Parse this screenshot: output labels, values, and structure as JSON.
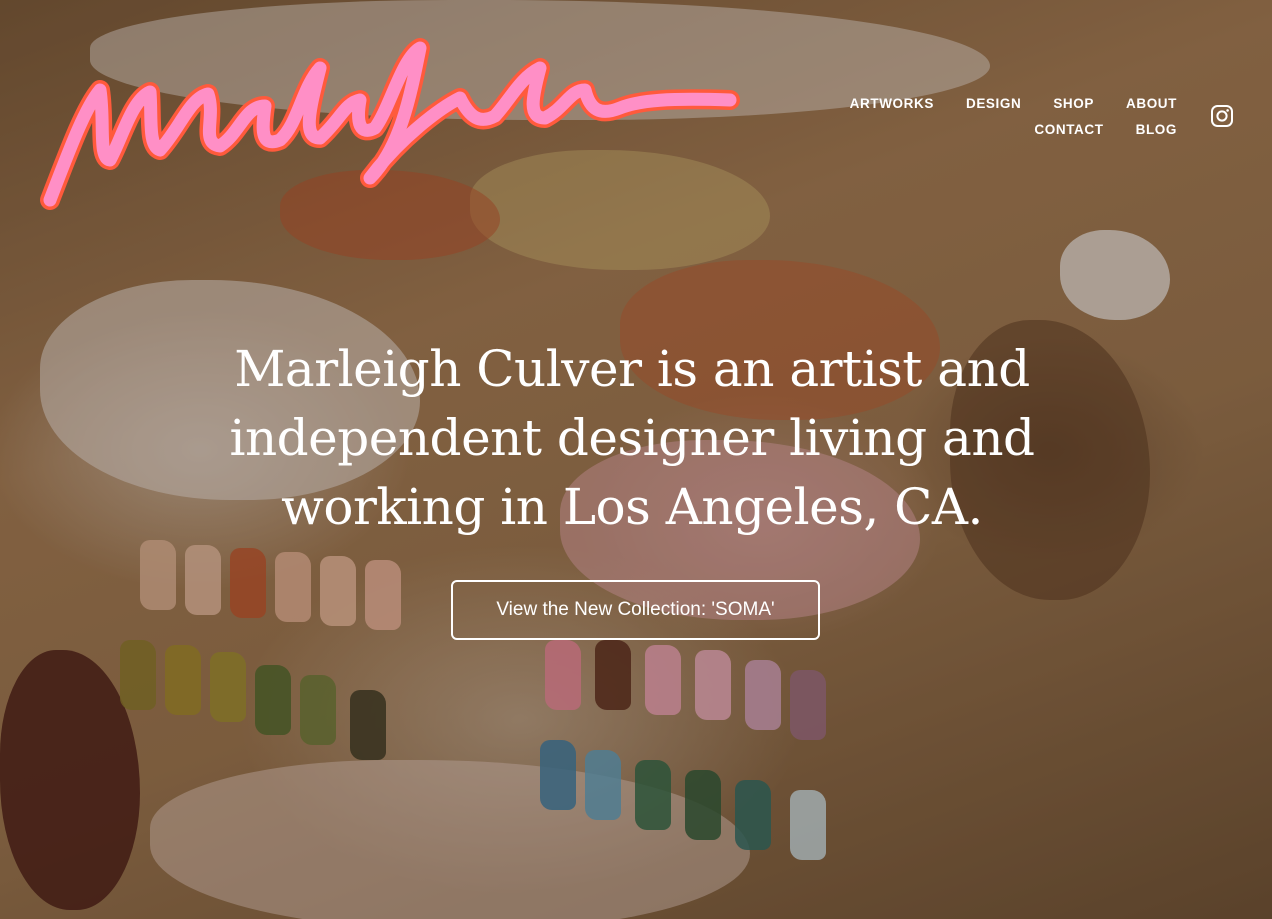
{
  "brand": {
    "logo_text": "Marleigh Culver",
    "logo_color": "#ff7ec0",
    "logo_outline": "#ff5a3c"
  },
  "nav": {
    "items": [
      {
        "label": "ARTWORKS"
      },
      {
        "label": "DESIGN"
      },
      {
        "label": "SHOP"
      },
      {
        "label": "ABOUT"
      },
      {
        "label": "CONTACT"
      },
      {
        "label": "BLOG"
      }
    ],
    "social_icon": "instagram-icon"
  },
  "hero": {
    "headline": "Marleigh Culver is an artist and independent designer living and working in Los Angeles, CA.",
    "cta_label": "View the New Collection: 'SOMA'"
  },
  "colors": {
    "text": "#ffffff"
  }
}
